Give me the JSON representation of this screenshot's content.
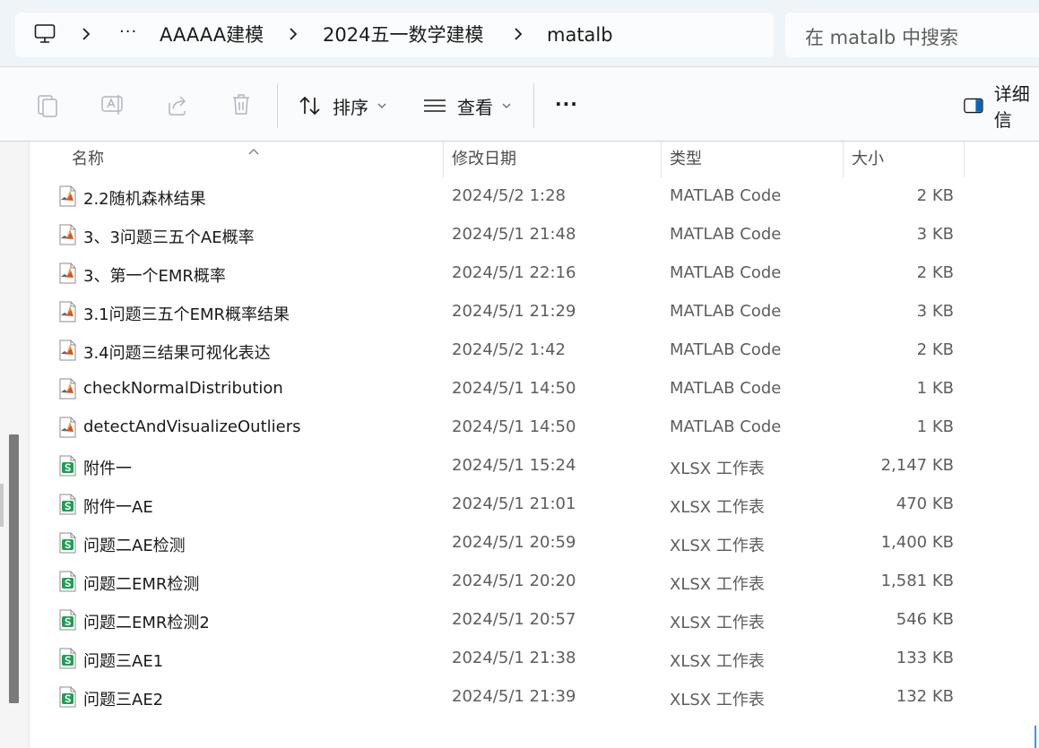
{
  "address_bar": {
    "ellipsis": "···",
    "crumbs": [
      "AAAAA建模",
      "2024五一数学建模",
      "matalb"
    ]
  },
  "search": {
    "placeholder": "在 matalb 中搜索"
  },
  "commands": {
    "sort_label": "排序",
    "view_label": "查看",
    "more_label": "···",
    "details_label": "详细信"
  },
  "columns": {
    "name": "名称",
    "modified": "修改日期",
    "type": "类型",
    "size": "大小"
  },
  "files": [
    {
      "name": "2.2随机森林结果",
      "modified": "2024/5/2 1:28",
      "type": "MATLAB Code",
      "size": "2 KB",
      "icon": "matlab-file-icon"
    },
    {
      "name": "3、3问题三五个AE概率",
      "modified": "2024/5/1 21:48",
      "type": "MATLAB Code",
      "size": "3 KB",
      "icon": "matlab-file-icon"
    },
    {
      "name": "3、第一个EMR概率",
      "modified": "2024/5/1 22:16",
      "type": "MATLAB Code",
      "size": "2 KB",
      "icon": "matlab-file-icon"
    },
    {
      "name": "3.1问题三五个EMR概率结果",
      "modified": "2024/5/1 21:29",
      "type": "MATLAB Code",
      "size": "3 KB",
      "icon": "matlab-file-icon"
    },
    {
      "name": "3.4问题三结果可视化表达",
      "modified": "2024/5/2 1:42",
      "type": "MATLAB Code",
      "size": "2 KB",
      "icon": "matlab-file-icon"
    },
    {
      "name": "checkNormalDistribution",
      "modified": "2024/5/1 14:50",
      "type": "MATLAB Code",
      "size": "1 KB",
      "icon": "matlab-file-icon"
    },
    {
      "name": "detectAndVisualizeOutliers",
      "modified": "2024/5/1 14:50",
      "type": "MATLAB Code",
      "size": "1 KB",
      "icon": "matlab-file-icon"
    },
    {
      "name": "附件一",
      "modified": "2024/5/1 15:24",
      "type": "XLSX 工作表",
      "size": "2,147 KB",
      "icon": "xlsx-file-icon"
    },
    {
      "name": "附件一AE",
      "modified": "2024/5/1 21:01",
      "type": "XLSX 工作表",
      "size": "470 KB",
      "icon": "xlsx-file-icon"
    },
    {
      "name": "问题二AE检测",
      "modified": "2024/5/1 20:59",
      "type": "XLSX 工作表",
      "size": "1,400 KB",
      "icon": "xlsx-file-icon"
    },
    {
      "name": "问题二EMR检测",
      "modified": "2024/5/1 20:20",
      "type": "XLSX 工作表",
      "size": "1,581 KB",
      "icon": "xlsx-file-icon"
    },
    {
      "name": "问题二EMR检测2",
      "modified": "2024/5/1 20:57",
      "type": "XLSX 工作表",
      "size": "546 KB",
      "icon": "xlsx-file-icon"
    },
    {
      "name": "问题三AE1",
      "modified": "2024/5/1 21:38",
      "type": "XLSX 工作表",
      "size": "133 KB",
      "icon": "xlsx-file-icon"
    },
    {
      "name": "问题三AE2",
      "modified": "2024/5/1 21:39",
      "type": "XLSX 工作表",
      "size": "132 KB",
      "icon": "xlsx-file-icon"
    }
  ],
  "colors": {
    "xlsx_green": "#1f9e54",
    "matlab_orange": "#d9531e",
    "matlab_blue": "#2f6db5",
    "accent": "#0067c0"
  }
}
